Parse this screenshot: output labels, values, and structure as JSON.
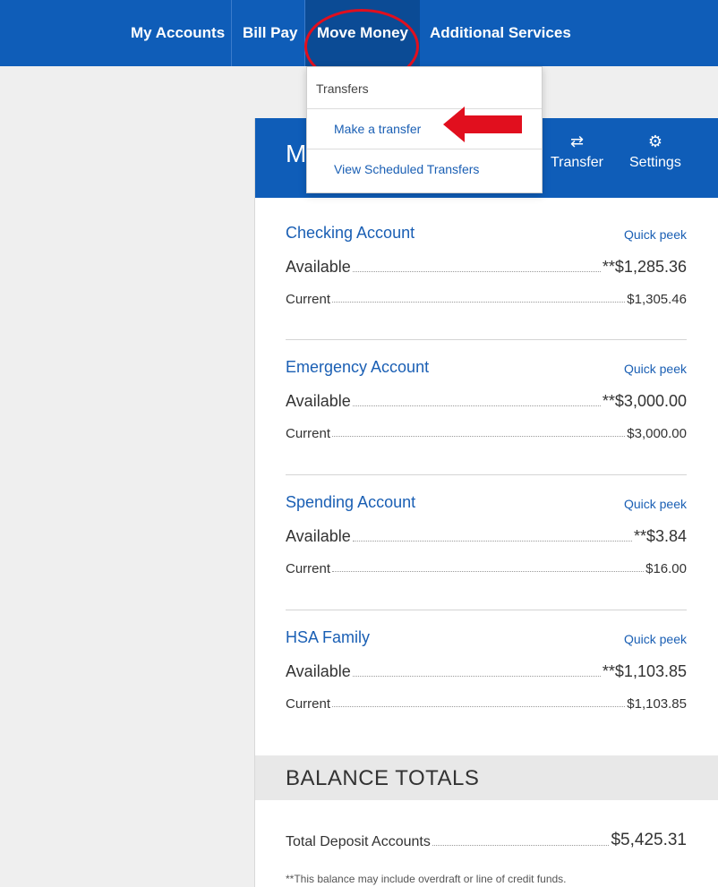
{
  "nav": {
    "items": [
      "My Accounts",
      "Bill Pay",
      "Move Money",
      "Additional Services"
    ],
    "active": "Move Money"
  },
  "panel": {
    "title": "M",
    "actions": [
      {
        "label": "Transfer",
        "icon": "transfer-icon"
      },
      {
        "label": "Settings",
        "icon": "gear-icon"
      }
    ]
  },
  "accounts": [
    {
      "name": "Checking Account",
      "peek": "Quick peek",
      "available_label": "Available",
      "available": "**$1,285.36",
      "current_label": "Current",
      "current": "$1,305.46"
    },
    {
      "name": "Emergency Account",
      "peek": "Quick peek",
      "available_label": "Available",
      "available": "**$3,000.00",
      "current_label": "Current",
      "current": "$3,000.00"
    },
    {
      "name": "Spending Account",
      "peek": "Quick peek",
      "available_label": "Available",
      "available": "**$3.84",
      "current_label": "Current",
      "current": "$16.00"
    },
    {
      "name": "HSA Family",
      "peek": "Quick peek",
      "available_label": "Available",
      "available": "**$1,103.85",
      "current_label": "Current",
      "current": "$1,103.85"
    }
  ],
  "totals": {
    "title": "BALANCE TOTALS",
    "deposit_label": "Total Deposit Accounts",
    "deposit_value": "$5,425.31",
    "note": "**This balance may include overdraft or line of credit funds."
  },
  "dropdown": {
    "header": "Transfers",
    "items": [
      "Make a transfer",
      "View Scheduled Transfers"
    ]
  },
  "colors": {
    "brand": "#0f5db8",
    "link": "#1a5fb4",
    "highlight": "#e10f1e"
  }
}
